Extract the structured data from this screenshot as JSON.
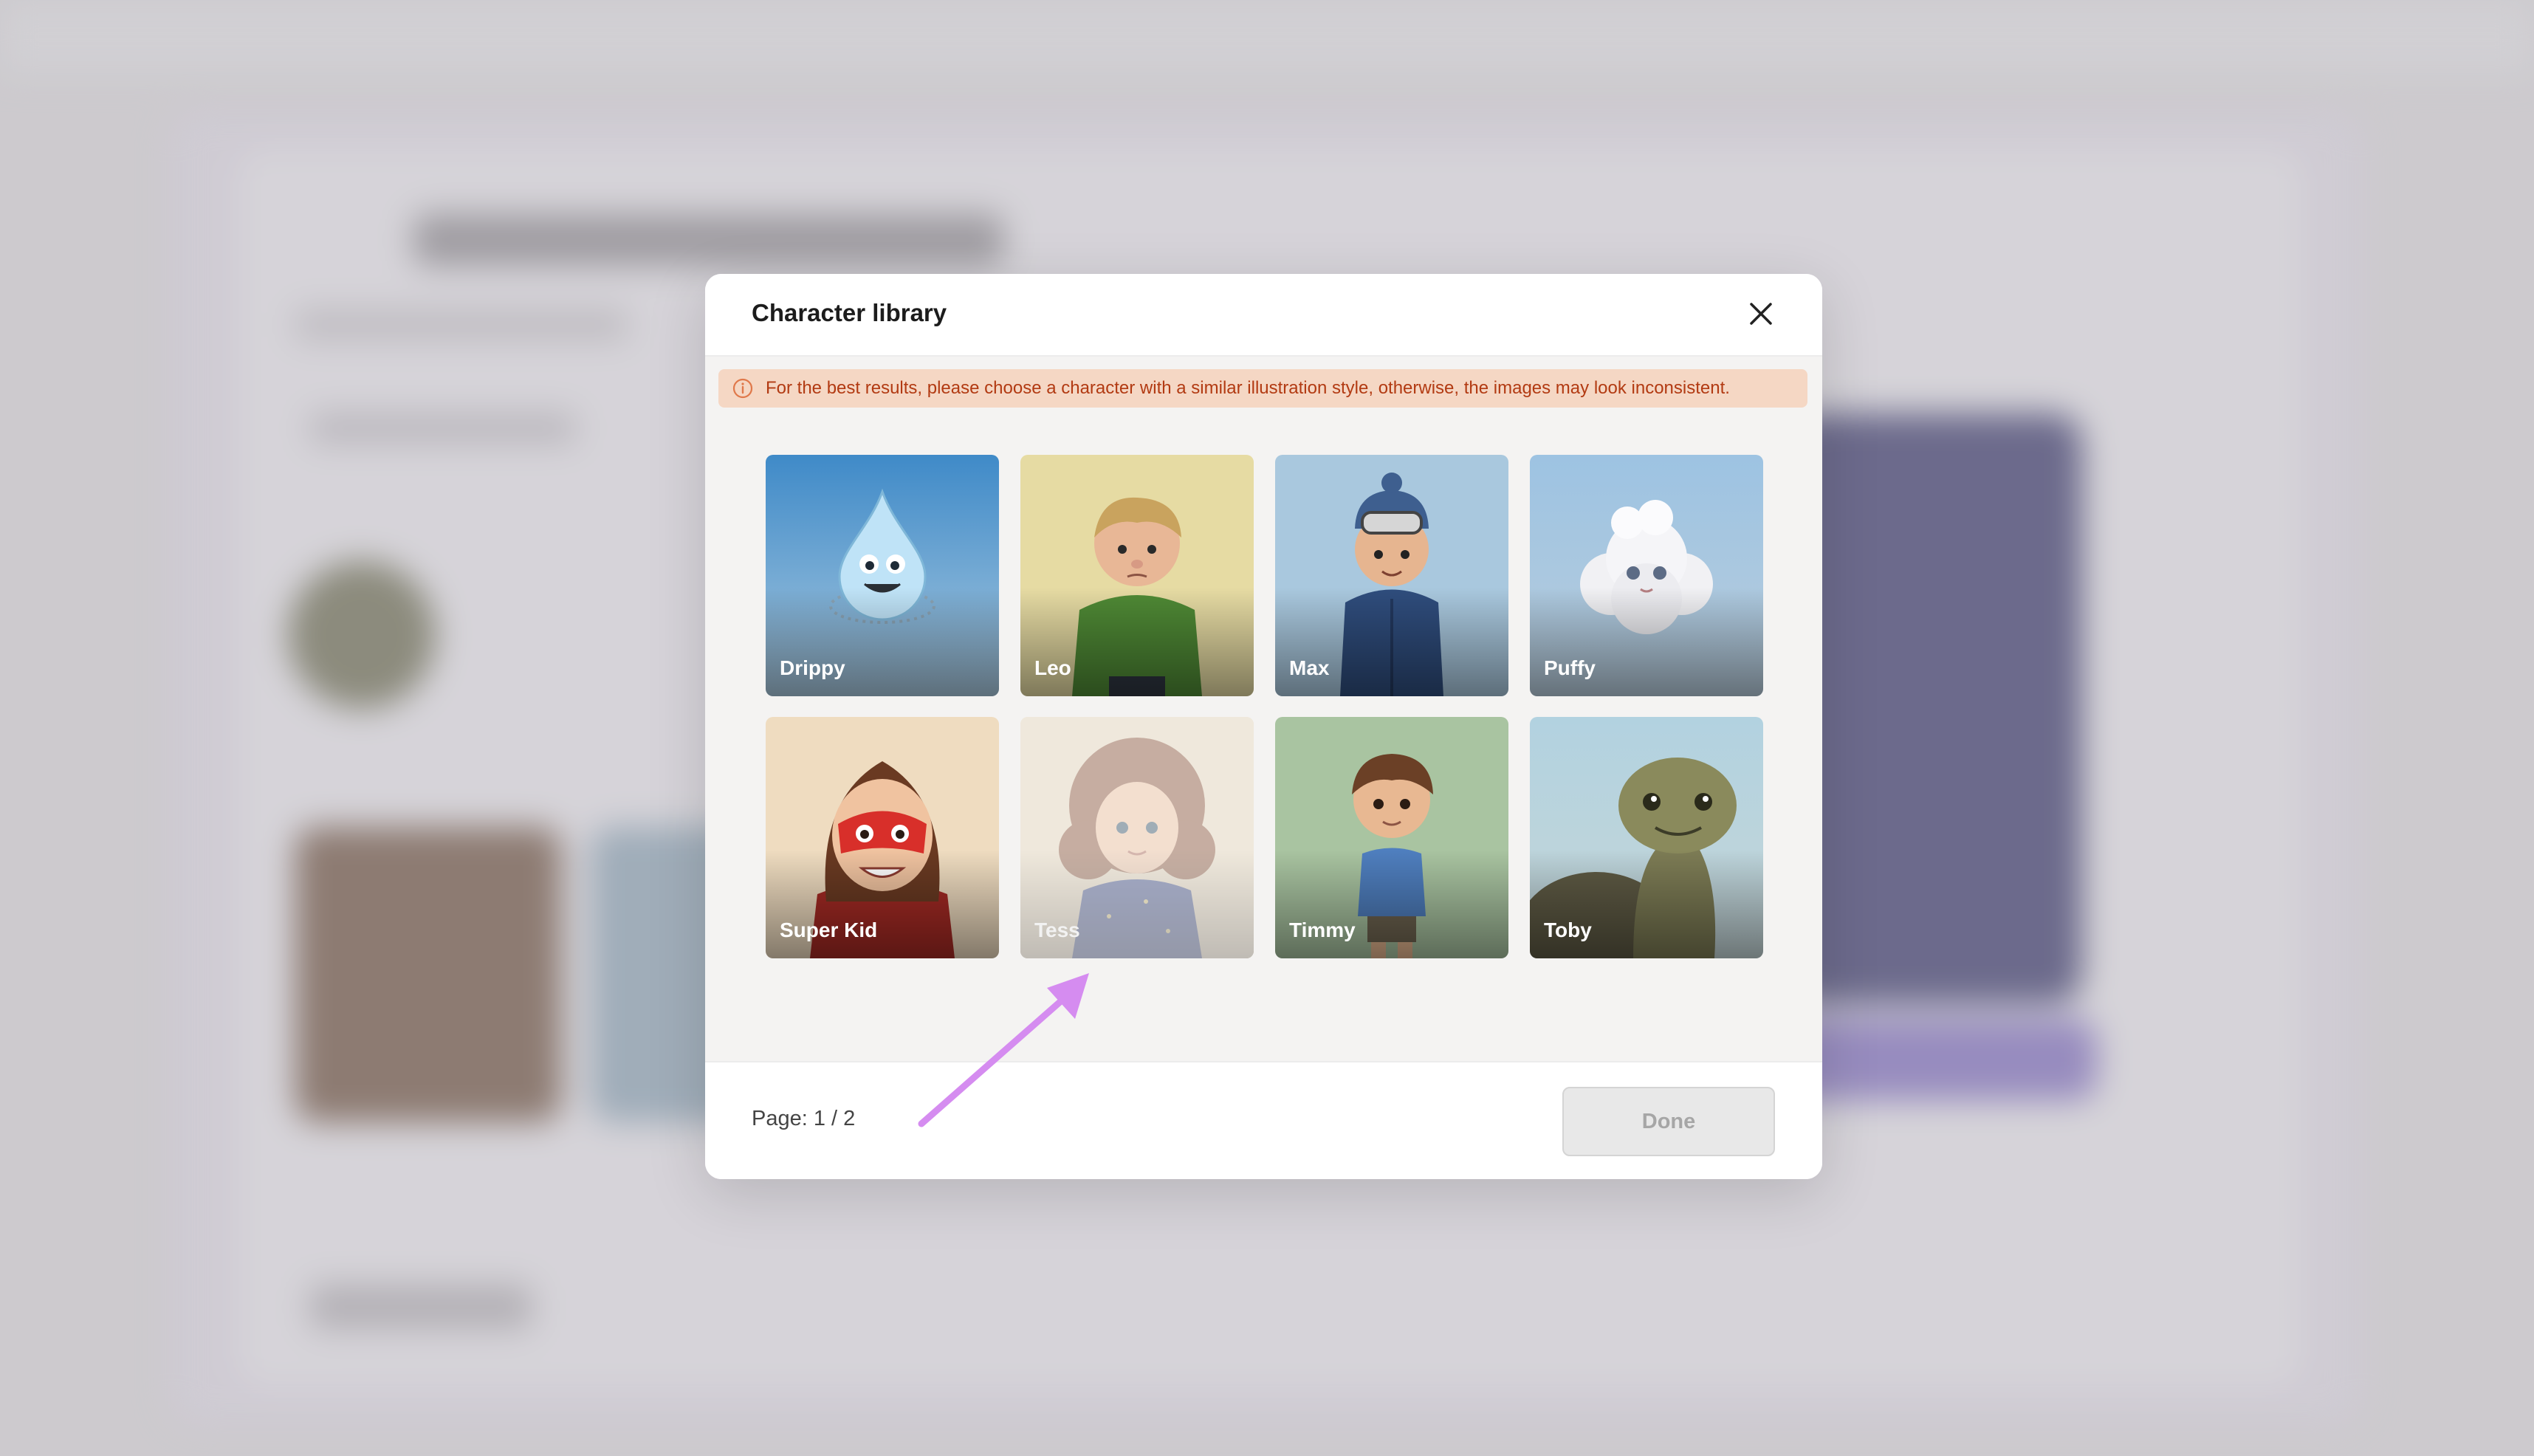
{
  "dialog": {
    "title": "Character library",
    "notice": "For the best results, please choose a character with a similar illustration style, otherwise, the images may look inconsistent."
  },
  "characters": [
    {
      "name": "Drippy",
      "selected": false,
      "disabled": false
    },
    {
      "name": "Leo",
      "selected": false,
      "disabled": false
    },
    {
      "name": "Max",
      "selected": false,
      "disabled": false
    },
    {
      "name": "Puffy",
      "selected": false,
      "disabled": false
    },
    {
      "name": "Super Kid",
      "selected": false,
      "disabled": false
    },
    {
      "name": "Tess",
      "selected": false,
      "disabled": true
    },
    {
      "name": "Timmy",
      "selected": false,
      "disabled": false
    },
    {
      "name": "Toby",
      "selected": false,
      "disabled": false
    }
  ],
  "pagination": {
    "label": "Page: 1 / 2",
    "prev_enabled": false,
    "next_enabled": true
  },
  "footer": {
    "done_label": "Done",
    "done_enabled": false
  },
  "icons": {
    "close": "close-icon",
    "notice": "info-icon",
    "prev": "arrow-left-icon",
    "next": "arrow-right-icon"
  },
  "colors": {
    "notice_bg": "#f5d7c4",
    "notice_text": "#b23a12",
    "annotation_arrow": "#d58cf0"
  }
}
